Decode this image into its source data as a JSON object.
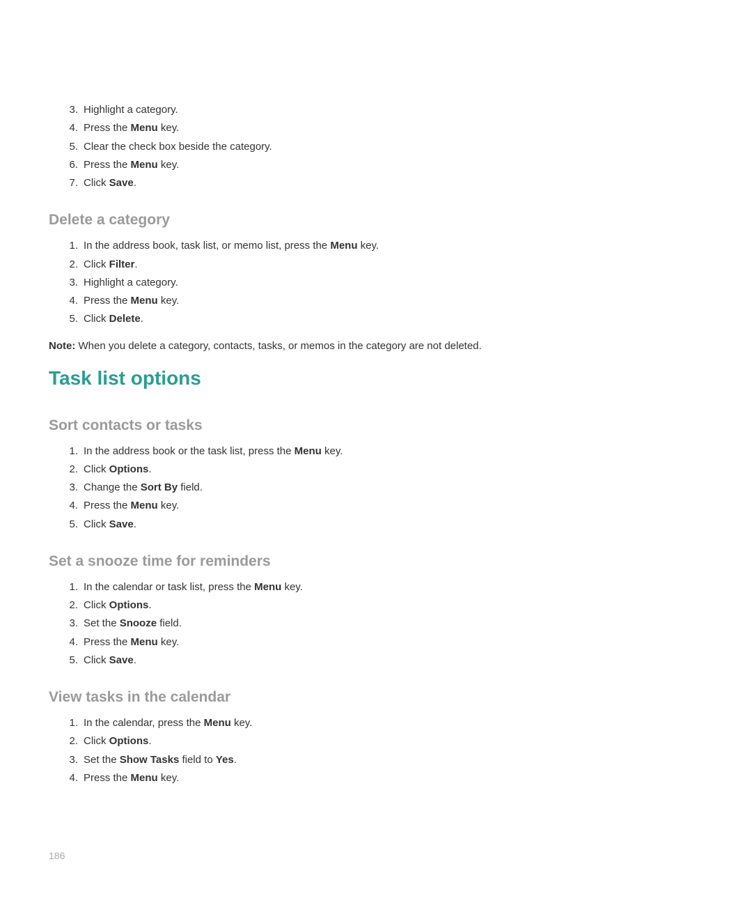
{
  "intro_list": {
    "start": 3,
    "items": [
      {
        "parts": [
          "Highlight a category."
        ]
      },
      {
        "parts": [
          "Press the ",
          {
            "bold": true,
            "text": "Menu"
          },
          " key."
        ]
      },
      {
        "parts": [
          "Clear the check box beside the category."
        ]
      },
      {
        "parts": [
          "Press the ",
          {
            "bold": true,
            "text": "Menu"
          },
          " key."
        ]
      },
      {
        "parts": [
          "Click ",
          {
            "bold": true,
            "text": "Save"
          },
          "."
        ]
      }
    ]
  },
  "section1": {
    "heading": "Delete a category",
    "items": [
      {
        "parts": [
          "In the address book, task list, or memo list, press the ",
          {
            "bold": true,
            "text": "Menu"
          },
          " key."
        ]
      },
      {
        "parts": [
          "Click ",
          {
            "bold": true,
            "text": "Filter"
          },
          "."
        ]
      },
      {
        "parts": [
          "Highlight a category."
        ]
      },
      {
        "parts": [
          "Press the ",
          {
            "bold": true,
            "text": "Menu"
          },
          " key."
        ]
      },
      {
        "parts": [
          "Click ",
          {
            "bold": true,
            "text": "Delete"
          },
          "."
        ]
      }
    ],
    "note_label": "Note:",
    "note_text": "  When you delete a category, contacts, tasks, or memos in the category are not deleted."
  },
  "h1": "Task list options",
  "section2": {
    "heading": "Sort contacts or tasks",
    "items": [
      {
        "parts": [
          "In the address book or the task list, press the ",
          {
            "bold": true,
            "text": "Menu"
          },
          " key."
        ]
      },
      {
        "parts": [
          "Click ",
          {
            "bold": true,
            "text": "Options"
          },
          "."
        ]
      },
      {
        "parts": [
          "Change the ",
          {
            "bold": true,
            "text": "Sort By"
          },
          " field."
        ]
      },
      {
        "parts": [
          "Press the ",
          {
            "bold": true,
            "text": "Menu"
          },
          " key."
        ]
      },
      {
        "parts": [
          "Click ",
          {
            "bold": true,
            "text": "Save"
          },
          "."
        ]
      }
    ]
  },
  "section3": {
    "heading": "Set a snooze time for reminders",
    "items": [
      {
        "parts": [
          "In the calendar or task list, press the ",
          {
            "bold": true,
            "text": "Menu"
          },
          " key."
        ]
      },
      {
        "parts": [
          "Click ",
          {
            "bold": true,
            "text": "Options"
          },
          "."
        ]
      },
      {
        "parts": [
          "Set the ",
          {
            "bold": true,
            "text": "Snooze"
          },
          " field."
        ]
      },
      {
        "parts": [
          "Press the ",
          {
            "bold": true,
            "text": "Menu"
          },
          " key."
        ]
      },
      {
        "parts": [
          "Click ",
          {
            "bold": true,
            "text": "Save"
          },
          "."
        ]
      }
    ]
  },
  "section4": {
    "heading": "View tasks in the calendar",
    "items": [
      {
        "parts": [
          "In the calendar, press the ",
          {
            "bold": true,
            "text": "Menu"
          },
          " key."
        ]
      },
      {
        "parts": [
          "Click ",
          {
            "bold": true,
            "text": "Options"
          },
          "."
        ]
      },
      {
        "parts": [
          "Set the ",
          {
            "bold": true,
            "text": "Show Tasks"
          },
          " field to ",
          {
            "bold": true,
            "text": "Yes"
          },
          "."
        ]
      },
      {
        "parts": [
          "Press the ",
          {
            "bold": true,
            "text": "Menu"
          },
          " key."
        ]
      }
    ]
  },
  "page_number": "186"
}
